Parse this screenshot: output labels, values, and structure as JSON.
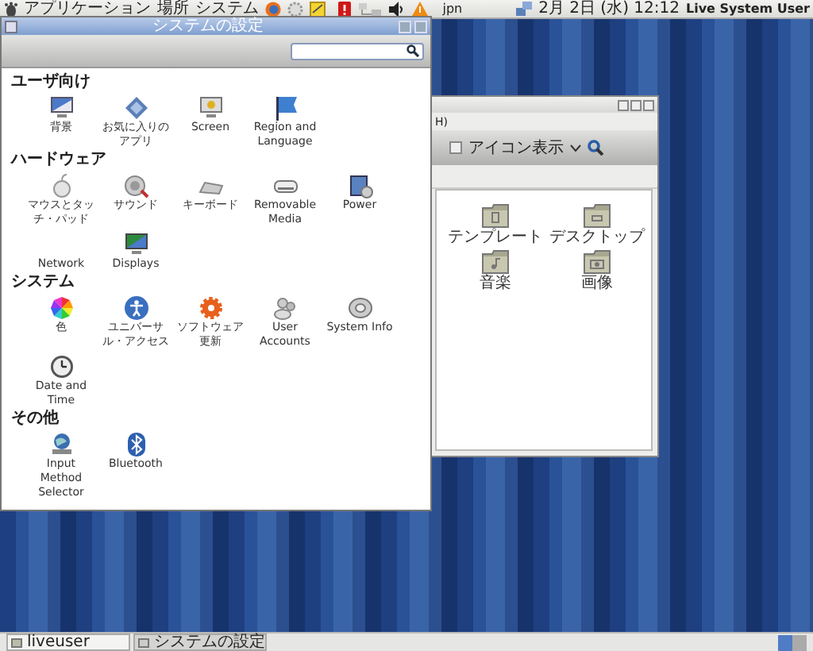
{
  "top_panel": {
    "menus": [
      "アプリケーション",
      "場所",
      "システム"
    ],
    "keyboard_layout": "jpn",
    "clock": "2月 2日 (水) 12:12",
    "user": "Live System User"
  },
  "settings_window": {
    "title": "システムの設定",
    "sections": [
      {
        "title": "ユーザ向け",
        "items": [
          "背景",
          "お気に入りのアプリ",
          "Screen",
          "Region and Language"
        ]
      },
      {
        "title": "ハードウェア",
        "items": [
          "マウスとタッチ・パッド",
          "サウンド",
          "キーボード",
          "Removable Media",
          "Power",
          "Network",
          "Displays"
        ]
      },
      {
        "title": "システム",
        "items": [
          "色",
          "ユニバーサル・アクセス",
          "ソフトウェア更新",
          "User Accounts",
          "System Info",
          "Date and Time"
        ]
      },
      {
        "title": "その他",
        "items": [
          "Input Method Selector",
          "Bluetooth"
        ]
      }
    ]
  },
  "file_window": {
    "menu_fragment": "H)",
    "view_mode": "アイコン表示",
    "folders": [
      "テンプレート",
      "デスクトップ",
      "音楽",
      "画像"
    ]
  },
  "taskbar": {
    "buttons": [
      "liveuser",
      "システムの設定"
    ]
  }
}
